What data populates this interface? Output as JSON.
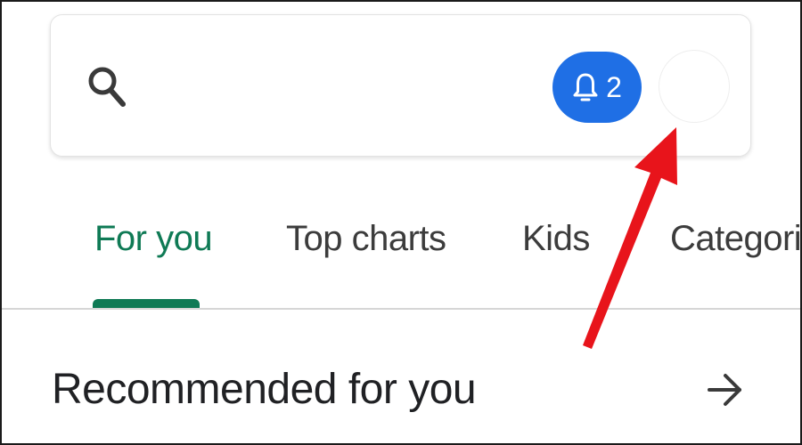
{
  "search": {
    "icon": "search-icon"
  },
  "notifications": {
    "icon": "bell-icon",
    "count": "2",
    "background_color": "#1f6fe5"
  },
  "account": {
    "icon": "avatar"
  },
  "tabs": [
    {
      "label": "For you",
      "active": true
    },
    {
      "label": "Top charts",
      "active": false
    },
    {
      "label": "Kids",
      "active": false
    },
    {
      "label": "Categorie",
      "active": false
    }
  ],
  "section": {
    "title": "Recommended for you",
    "more_icon": "arrow-right-icon"
  },
  "colors": {
    "active_tab": "#0f7a55",
    "annotation_arrow": "#e8141b"
  }
}
